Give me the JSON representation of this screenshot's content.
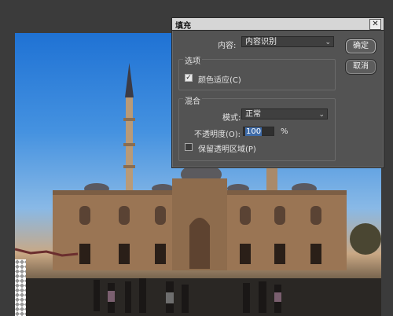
{
  "dialog": {
    "title": "填充",
    "close_glyph": "✕",
    "content_label": "内容:",
    "content_value": "内容识别",
    "options_group_label": "选项",
    "color_adapt_label": "颜色适应(C)",
    "color_adapt_checked": true,
    "blend_group_label": "混合",
    "mode_label": "模式:",
    "mode_value": "正常",
    "opacity_label": "不透明度(O):",
    "opacity_value": "100",
    "opacity_unit": "%",
    "preserve_transparency_label": "保留透明区域(P)",
    "preserve_transparency_checked": false,
    "ok_label": "确定",
    "cancel_label": "取消"
  },
  "icons": {
    "close": "close-icon",
    "dropdown": "chevron-down-icon",
    "check": "checkmark-icon"
  },
  "colors": {
    "dialog_bg": "#535353",
    "titlebar_bg": "#d6d6d6",
    "selection": "#3e6ba8"
  }
}
